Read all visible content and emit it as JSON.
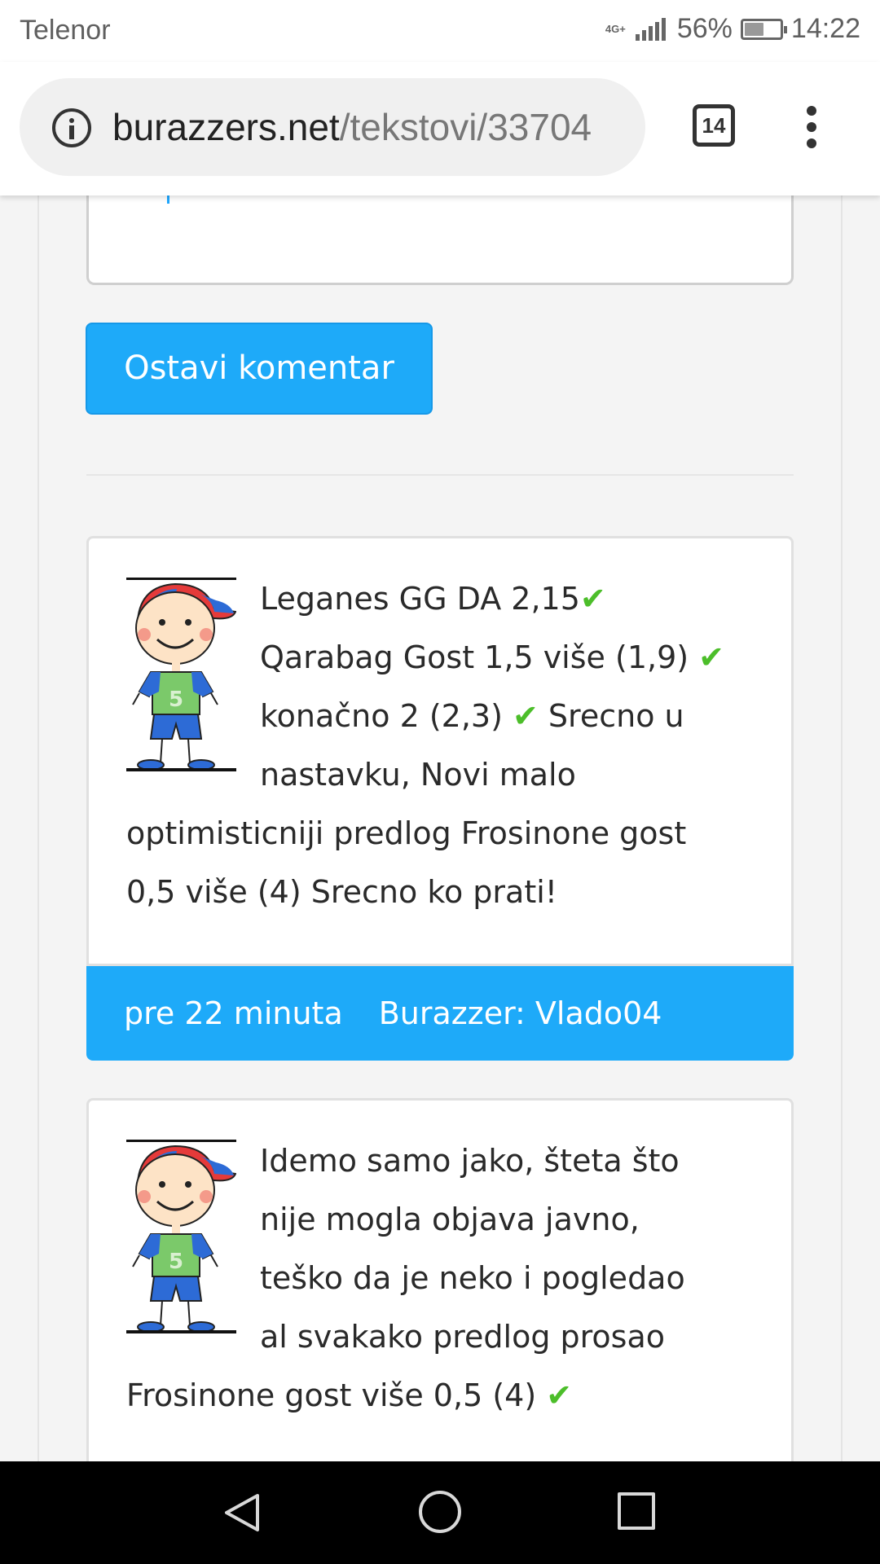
{
  "status_bar": {
    "carrier": "Telenor",
    "network": "4G+",
    "battery_percent": "56%",
    "battery_level": 0.56,
    "time": "14:22"
  },
  "browser": {
    "url_host": "burazzers.net",
    "url_path": "/tekstovi/33704",
    "tab_count": "14",
    "icons": [
      "info-icon",
      "tab-switcher-icon",
      "menu-icon"
    ]
  },
  "form": {
    "submit_label": "Ostavi komentar"
  },
  "colors": {
    "accent": "#1eaaf9",
    "check": "#4cbe2a",
    "text": "#2a2a2a"
  },
  "comments": [
    {
      "lines": [
        [
          "Leganes GG DA 2,15",
          "✔"
        ],
        [
          "Qarabag Gost 1,5 više (1,9) ",
          "✔"
        ],
        [
          "konačno 2 (2,3) ",
          "✔",
          " Srecno u"
        ],
        [
          "nastavku, Novi malo"
        ],
        [
          "optimisticniji predlog Frosinone gost"
        ],
        [
          "0,5 više (4) Srecno ko prati!"
        ]
      ],
      "time": "pre 22 minuta",
      "author": "Burazzer: Vlado04"
    },
    {
      "lines": [
        [
          "Idemo samo jako, šteta što"
        ],
        [
          "nije mogla objava javno,"
        ],
        [
          "teško da je neko i pogledao"
        ],
        [
          "al svakako predlog prosao"
        ],
        [
          "Frosinone gost više 0,5 (4) ",
          "✔"
        ]
      ]
    }
  ]
}
